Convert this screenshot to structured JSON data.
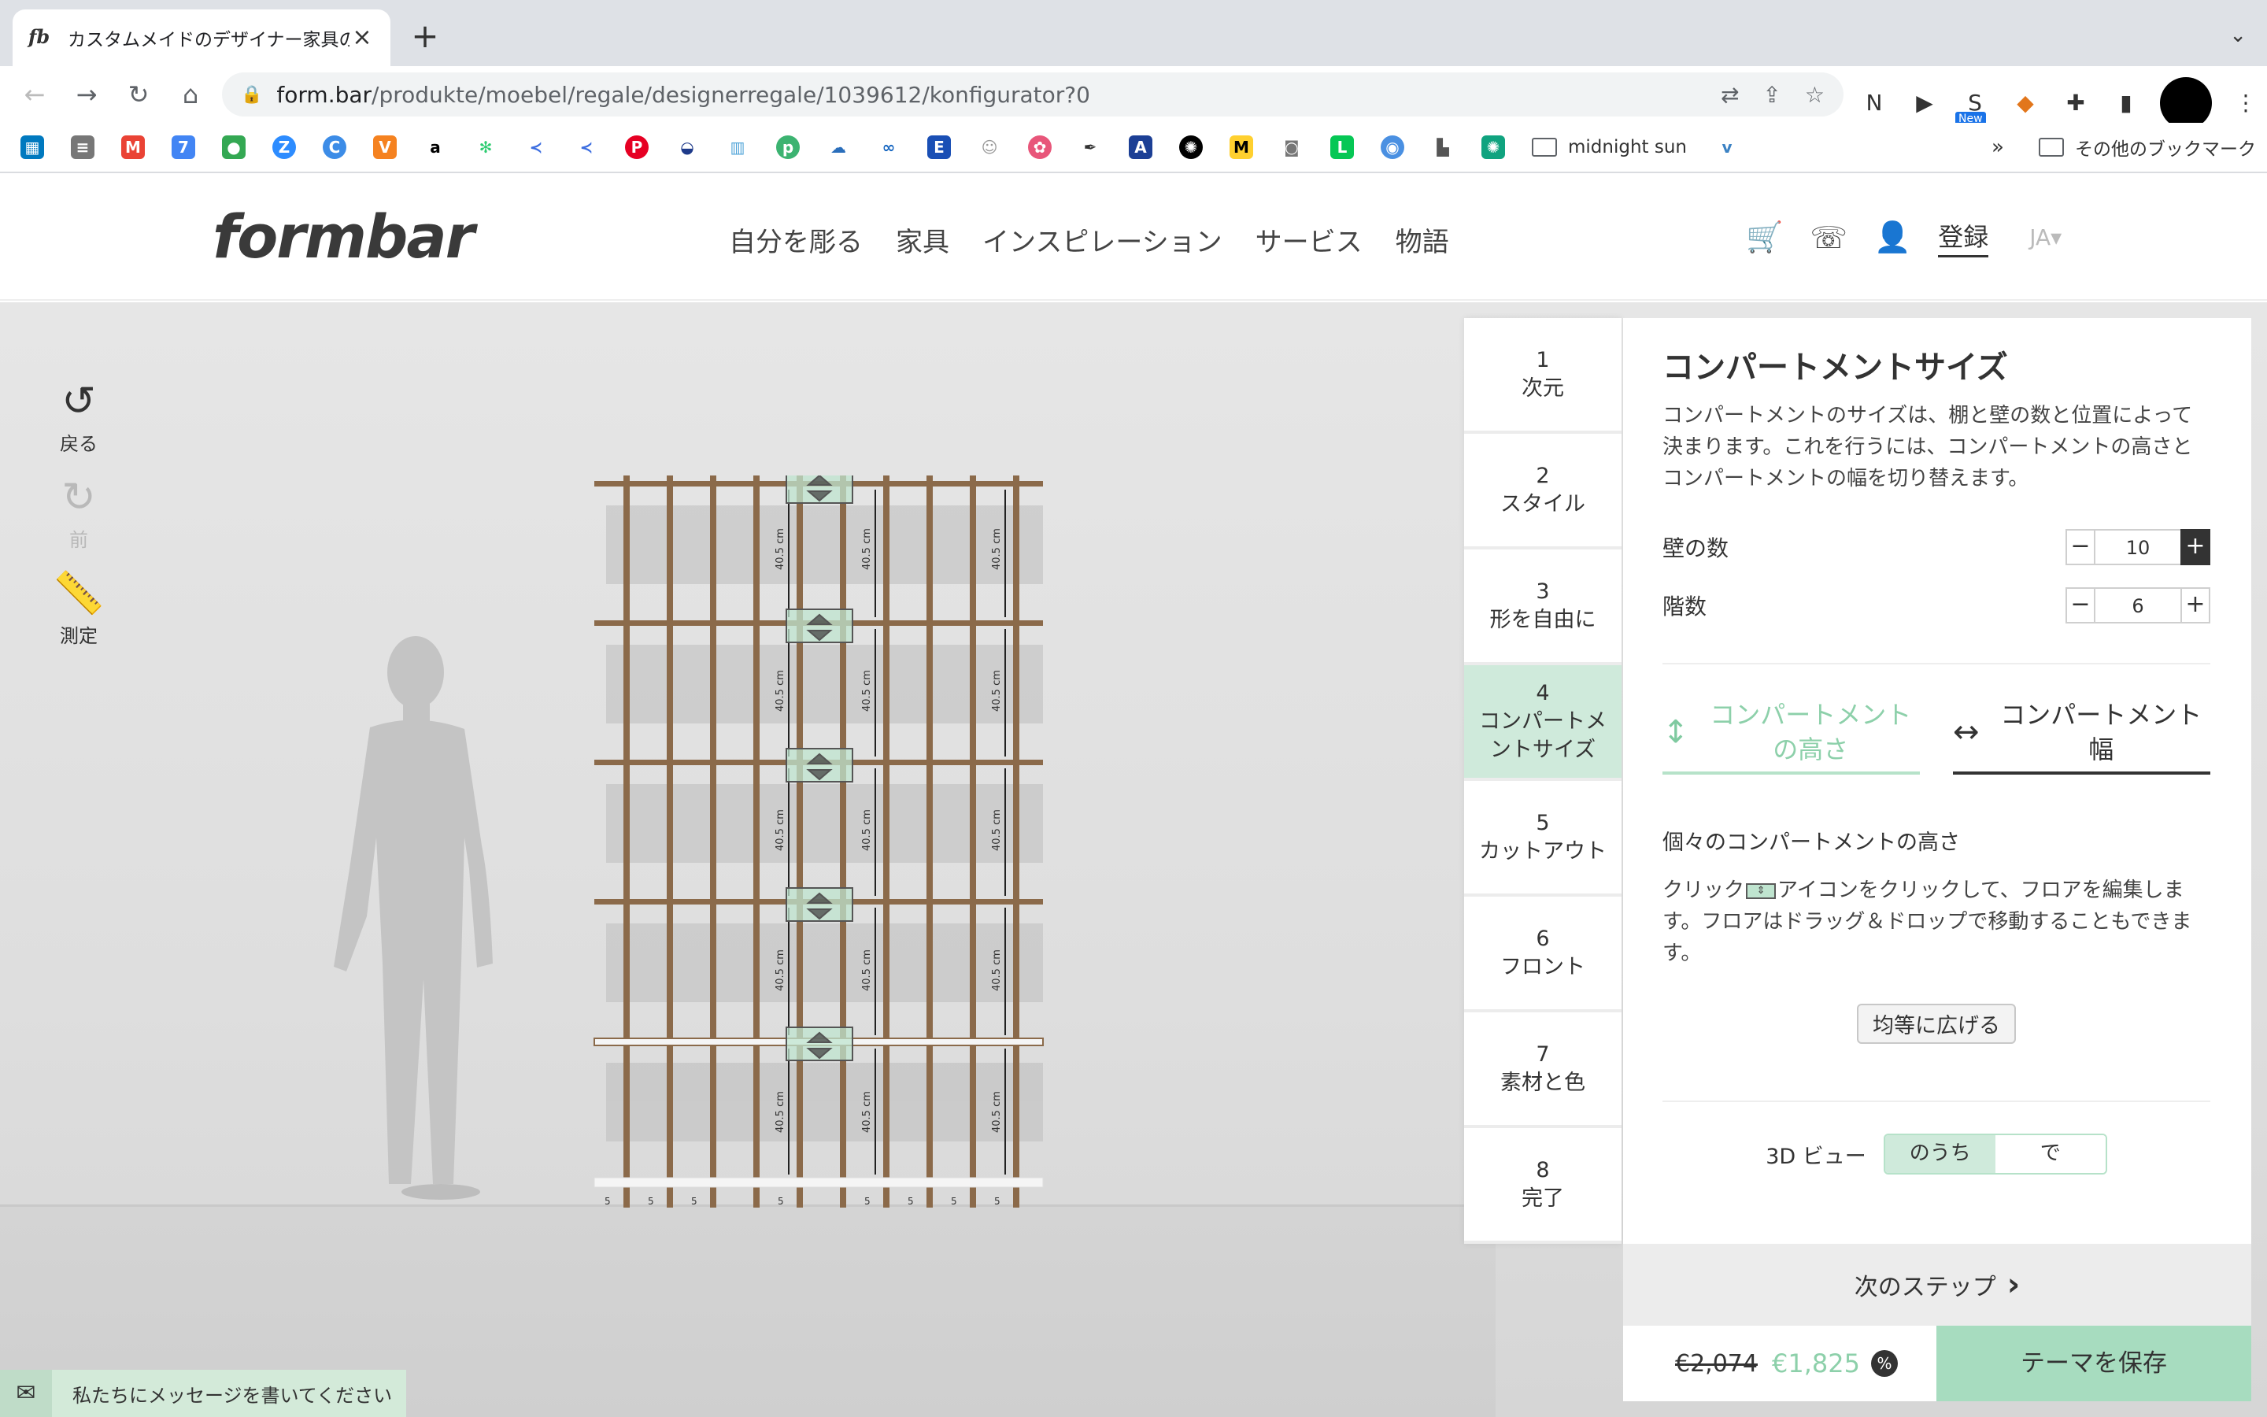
{
  "browser": {
    "tab_title": "カスタムメイドのデザイナー家具の",
    "tab_favicon": "fb",
    "url_host": "form.bar",
    "url_path": "/produkte/moebel/regale/designerregale/1039612/konfigurator?0",
    "ext_new_badge": "New",
    "bookmark_folder": "midnight sun",
    "bookmark_more": "»",
    "other_bookmarks": "その他のブックマーク"
  },
  "site": {
    "logo": "formbar",
    "nav": [
      "自分を彫る",
      "家具",
      "インスピレーション",
      "サービス",
      "物語"
    ],
    "login": "登録",
    "lang": "JA▾"
  },
  "tools": {
    "undo": "戻る",
    "redo": "前",
    "measure": "測定"
  },
  "steps": [
    {
      "num": "1",
      "label": "次元"
    },
    {
      "num": "2",
      "label": "スタイル"
    },
    {
      "num": "3",
      "label": "形を自由に"
    },
    {
      "num": "4",
      "label": "コンパートメ ントサイズ"
    },
    {
      "num": "5",
      "label": "カットアウト"
    },
    {
      "num": "6",
      "label": "フロント"
    },
    {
      "num": "7",
      "label": "素材と色"
    },
    {
      "num": "8",
      "label": "完了"
    }
  ],
  "panel": {
    "title": "コンパートメントサイズ",
    "description": "コンパートメントのサイズは、棚と壁の数と位置によって決まります。これを行うには、コンパートメントの高さとコンパートメントの幅を切り替えます。",
    "walls_label": "壁の数",
    "walls_value": "10",
    "floors_label": "階数",
    "floors_value": "6",
    "tab_height": "コンパートメントの高さ",
    "tab_width": "コンパートメント幅",
    "sub_title": "個々のコンパートメントの高さ",
    "hint_before": "クリック",
    "hint_after": "アイコンをクリックして、フロアを編集します。フロアはドラッグ＆ドロップで移動することもできます。",
    "distribute": "均等に広げる",
    "view_label": "3D ビュー",
    "view_on": "のうち",
    "view_off": "で"
  },
  "footer": {
    "next_step": "次のステップ",
    "price_old": "€2,074",
    "price_new": "€1,825",
    "pct": "%",
    "save": "テーマを保存",
    "chat": "私たちにメッセージを書いてください"
  },
  "shelf": {
    "dimension_label": "40.5 cm",
    "base_label": "5"
  },
  "colors": {
    "accent_green": "#a7dcbf",
    "active_step": "#cfeadb",
    "wood": "#8b6a4a"
  }
}
